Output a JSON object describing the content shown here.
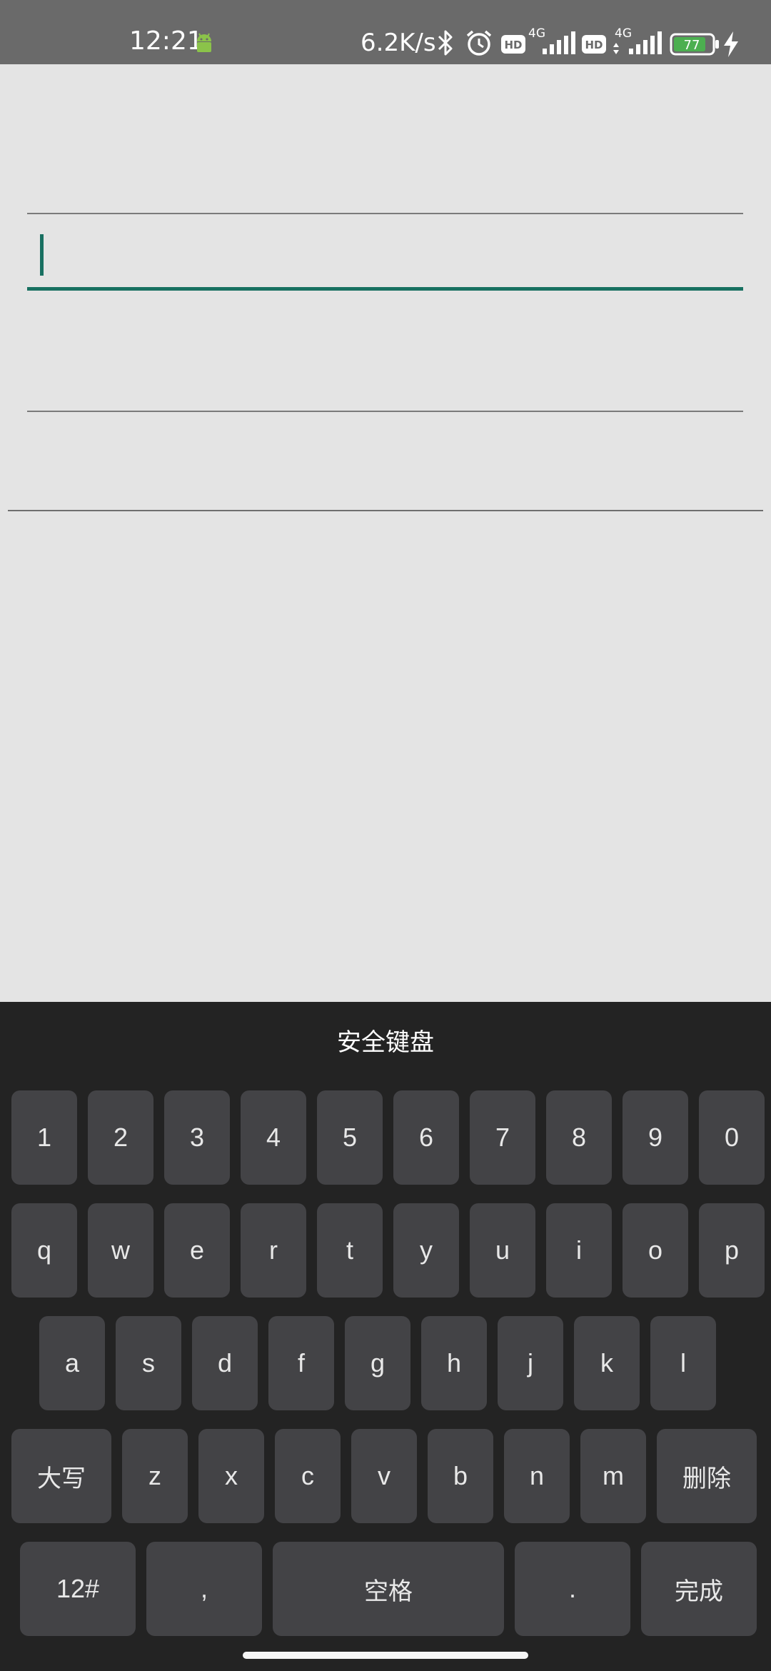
{
  "status_bar": {
    "time": "12:21",
    "net_speed": "6.2K/s",
    "hd_badge_1": "HD",
    "network_1": "4G",
    "hd_badge_2": "HD",
    "network_2": "4G",
    "battery": "77",
    "icons": [
      "android-icon",
      "bluetooth-icon",
      "alarm-icon",
      "signal-icon",
      "battery-icon",
      "charging-icon"
    ],
    "colors": {
      "background": "#6a6a6a",
      "battery_fill": "#4caf50"
    }
  },
  "form": {
    "fields": [
      {
        "name": "field-1",
        "value": ""
      },
      {
        "name": "field-2",
        "value": "",
        "focused": true
      },
      {
        "name": "field-3",
        "value": ""
      }
    ],
    "accent_color": "#187061"
  },
  "keyboard": {
    "title": "安全键盘",
    "row1": [
      "1",
      "2",
      "3",
      "4",
      "5",
      "6",
      "7",
      "8",
      "9",
      "0"
    ],
    "row2": [
      "q",
      "w",
      "e",
      "r",
      "t",
      "y",
      "u",
      "i",
      "o",
      "p"
    ],
    "row3": [
      "a",
      "s",
      "d",
      "f",
      "g",
      "h",
      "j",
      "k",
      "l"
    ],
    "row4": {
      "shift": "大写",
      "letters": [
        "z",
        "x",
        "c",
        "v",
        "b",
        "n",
        "m"
      ],
      "delete": "删除"
    },
    "row5": {
      "symbols": "12#",
      "comma": ",",
      "space": "空格",
      "period": ".",
      "done": "完成"
    },
    "colors": {
      "background": "#232323",
      "key": "#434346",
      "key_text": "#e8e8e8"
    }
  }
}
